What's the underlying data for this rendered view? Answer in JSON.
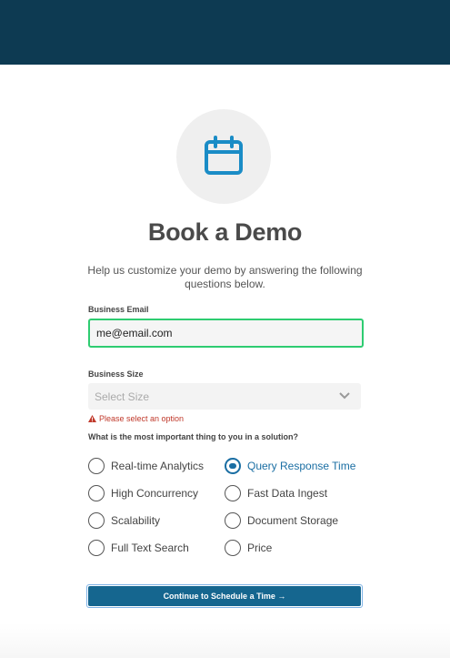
{
  "colors": {
    "header_bg": "#0d3a52",
    "accent": "#1a6ea3",
    "button_bg": "#15668f",
    "valid_border": "#2ecc71",
    "error": "#c0392b"
  },
  "hero": {
    "icon": "calendar-icon",
    "title": "Book a Demo",
    "subtitle": "Help us customize your demo by answering the following questions below."
  },
  "form": {
    "email": {
      "label": "Business Email",
      "value": "me@email.com"
    },
    "size": {
      "label": "Business Size",
      "selected": "Select Size",
      "error": "Please select an option"
    },
    "priority": {
      "question": "What is the most important thing to you in a solution?",
      "options": [
        {
          "label": "Real-time Analytics",
          "checked": false
        },
        {
          "label": "Query Response Time",
          "checked": true
        },
        {
          "label": "High Concurrency",
          "checked": false
        },
        {
          "label": "Fast Data Ingest",
          "checked": false
        },
        {
          "label": "Scalability",
          "checked": false
        },
        {
          "label": "Document Storage",
          "checked": false
        },
        {
          "label": "Full Text Search",
          "checked": false
        },
        {
          "label": "Price",
          "checked": false
        }
      ]
    },
    "submit_label": "Continue to Schedule a Time →"
  }
}
